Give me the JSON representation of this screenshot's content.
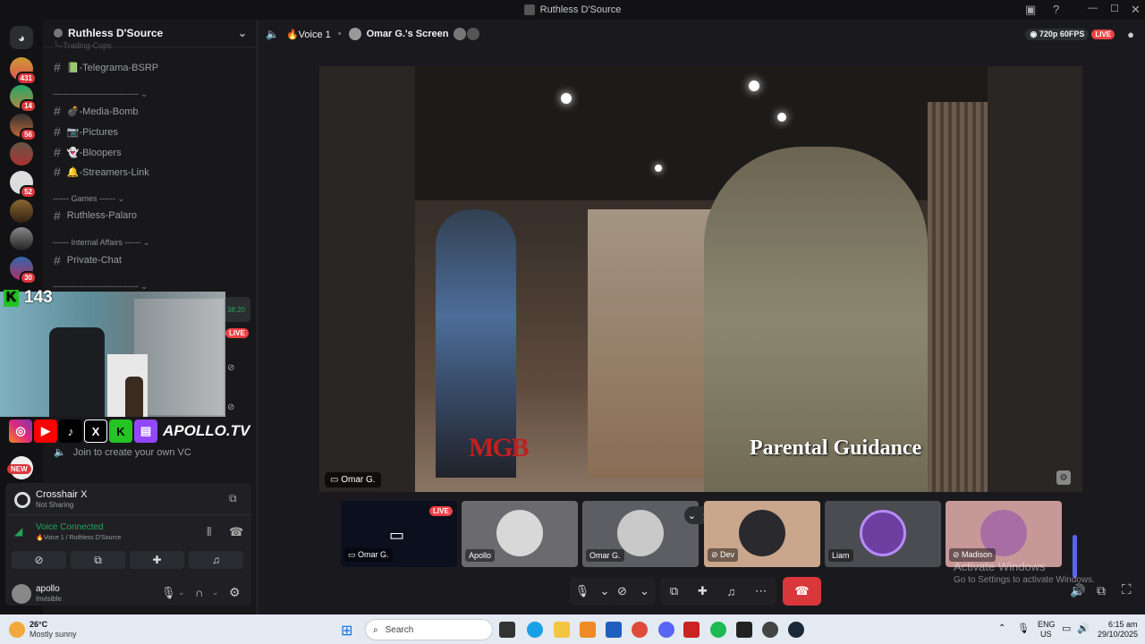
{
  "window": {
    "title": "Ruthless D'Source"
  },
  "servers": {
    "badges": [
      "431",
      "14",
      "56",
      "52",
      "30"
    ],
    "new_label": "NEW"
  },
  "sidebar": {
    "server_name": "Ruthless D'Source",
    "channels": {
      "partial_top": "╰–Trading-Cups",
      "telegrama": "📗-Telegrama-BSRP",
      "divider1": "-------------------------------- ⌄",
      "media": "💣-Media-Bomb",
      "pictures": "📷-Pictures",
      "bloopers": "👻-Bloopers",
      "streamers": "🔔-Streamers-Link",
      "games_cat": "------ Games ------ ⌄",
      "palaro": "Ruthless-Palaro",
      "affairs_cat": "------ Internal Affairs ------ ⌄",
      "private": "Private-Chat",
      "divider2": "-------------------------------- ⌄",
      "vc_time": "38:20",
      "live": "LIVE",
      "create_vc": "Join to create your own VC"
    }
  },
  "overlay": {
    "k_label": "K",
    "count": "143",
    "brand": "APOLLO.TV"
  },
  "activity": {
    "game": "Crosshair X",
    "game_status": "Not Sharing",
    "voice_status": "Voice Connected",
    "voice_location": "🔥Voice 1 / Ruthless D'Source"
  },
  "user": {
    "name": "apollo",
    "status": "Invisible"
  },
  "topbar": {
    "channel": "🔥Voice 1",
    "screen": "Omar G.'s Screen",
    "quality": "720p 60FPS",
    "live": "LIVE"
  },
  "stream": {
    "caption_logo": "MGB",
    "caption": "Parental Guidance",
    "presenter": "Omar G."
  },
  "tiles": [
    {
      "label": "Omar G.",
      "live": "LIVE"
    },
    {
      "label": "Apollo"
    },
    {
      "label": "Omar G."
    },
    {
      "label": "Dev"
    },
    {
      "label": "Liam"
    },
    {
      "label": "Madison"
    }
  ],
  "watermark": {
    "line1": "Activate Windows",
    "line2": "Go to Settings to activate Windows."
  },
  "taskbar": {
    "weather_temp": "26°C",
    "weather_desc": "Mostly sunny",
    "search_placeholder": "Search",
    "lang": "ENG",
    "region": "US",
    "time": "6:15 am",
    "date": "29/10/2025"
  },
  "colors": {
    "live_red": "#ed4245",
    "voice_green": "#23a55a",
    "end_call": "#da373c",
    "accent": "#5865f2"
  }
}
